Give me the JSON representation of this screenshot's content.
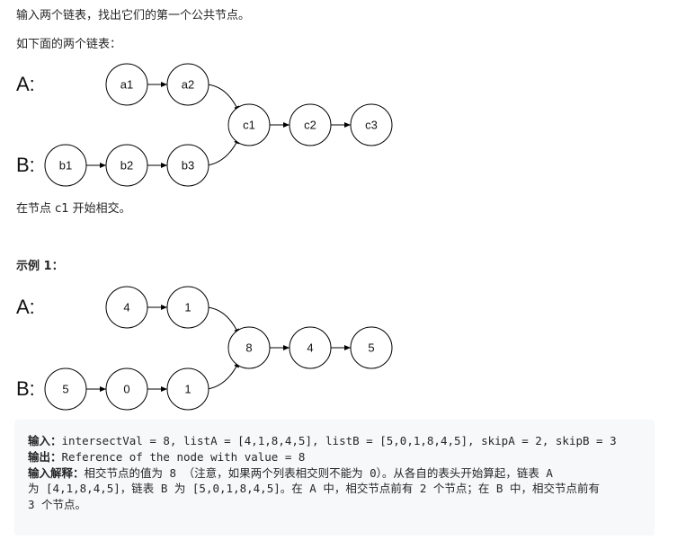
{
  "intro": "输入两个链表，找出它们的第一个公共节点。",
  "as_below": "如下面的两个链表：",
  "diagram1": {
    "label_a": "A:",
    "label_b": "B:",
    "a_nodes": [
      "a1",
      "a2"
    ],
    "b_nodes": [
      "b1",
      "b2",
      "b3"
    ],
    "shared_nodes": [
      "c1",
      "c2",
      "c3"
    ]
  },
  "intersect_note": "在节点 c1 开始相交。",
  "example_title": "示例 1：",
  "diagram2": {
    "label_a": "A:",
    "label_b": "B:",
    "a_nodes": [
      "4",
      "1"
    ],
    "b_nodes": [
      "5",
      "0",
      "1"
    ],
    "shared_nodes": [
      "8",
      "4",
      "5"
    ]
  },
  "example": {
    "input_key": "输入：",
    "input_value": "intersectVal = 8, listA = [4,1,8,4,5], listB = [5,0,1,8,4,5], skipA = 2, skipB = 3",
    "output_key": "输出：",
    "output_value": "Reference of the node with value = 8",
    "explain_key": "输入解释：",
    "explain_line1": "相交节点的值为 8 （注意，如果两个列表相交则不能为 0）。从各自的表头开始算起，链表 A",
    "explain_line2": "为 [4,1,8,4,5]，链表 B 为 [5,0,1,8,4,5]。在 A 中，相交节点前有 2 个节点；在 B 中，相交节点前有",
    "explain_line3": "3 个节点。"
  }
}
